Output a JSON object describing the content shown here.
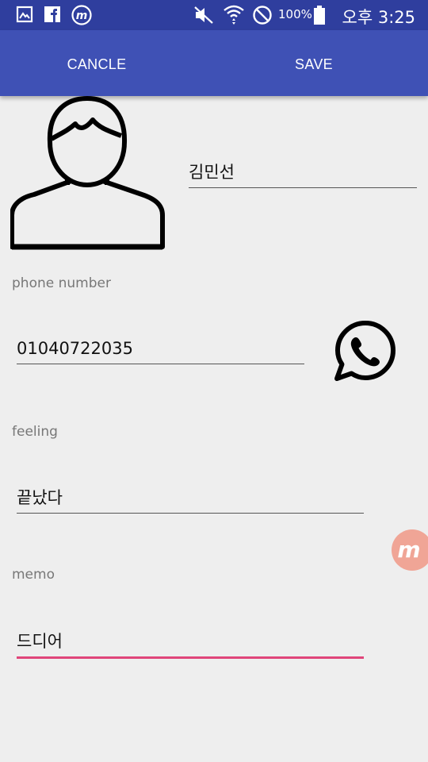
{
  "status_bar": {
    "battery_percent": "100%",
    "time": "오후 3:25",
    "icons": [
      "gallery-icon",
      "facebook-icon",
      "m-app-icon",
      "mute-icon",
      "wifi-icon",
      "do-not-disturb-icon",
      "battery-icon"
    ]
  },
  "app_bar": {
    "cancel_label": "CANCLE",
    "save_label": "SAVE",
    "color": "#3f51b5"
  },
  "contact": {
    "name": "김민선",
    "phone_label": "phone number",
    "phone_value": "01040722035",
    "feeling_label": "feeling",
    "feeling_value": "끝났다",
    "memo_label": "memo",
    "memo_value": "드디어"
  },
  "colors": {
    "status_bar": "#2f3e9e",
    "accent": "#e0457a",
    "background": "#eeeeee"
  },
  "floating_button": {
    "icon": "m-app-icon",
    "color": "#f0a596"
  }
}
